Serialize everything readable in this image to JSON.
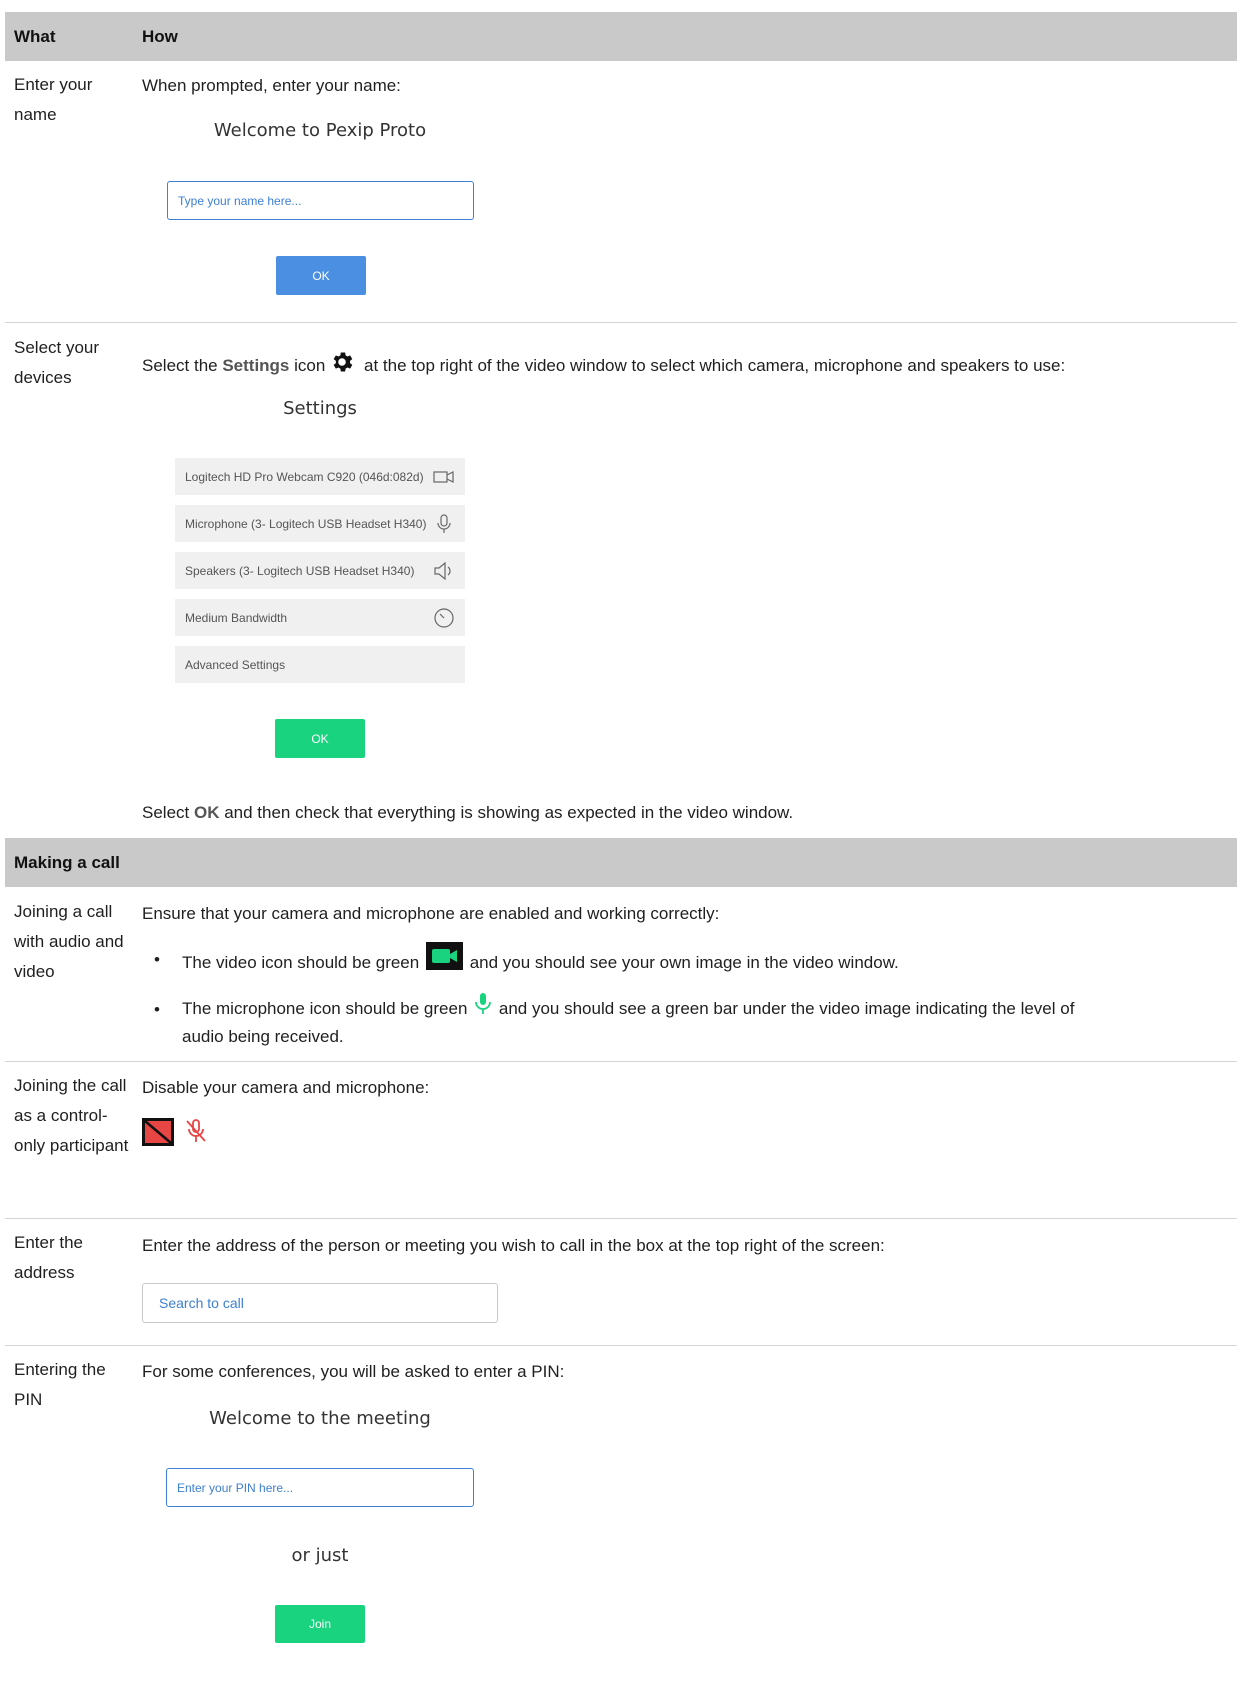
{
  "header": {
    "what": "What",
    "how": "How"
  },
  "rows": {
    "name": {
      "what": "Enter your name",
      "how": "When prompted, enter your name:",
      "ui_title": "Welcome to Pexip Proto",
      "ui_placeholder": "Type your name here...",
      "ui_button": "OK"
    },
    "devices": {
      "what": "Select your devices",
      "how_before": "Select the ",
      "how_bold": "Settings",
      "how_mid": " icon",
      "how_after": " at the top right of the video window to select which camera, microphone and speakers to use:",
      "ui_title": "Settings",
      "settings_items": [
        {
          "label": "Logitech HD Pro Webcam C920 (046d:082d)",
          "icon": "camera-icon"
        },
        {
          "label": "Microphone (3- Logitech USB Headset H340)",
          "icon": "microphone-icon"
        },
        {
          "label": "Speakers (3- Logitech USB Headset H340)",
          "icon": "speaker-icon"
        },
        {
          "label": "Medium Bandwidth",
          "icon": "speedometer-icon"
        },
        {
          "label": "Advanced Settings",
          "icon": ""
        }
      ],
      "ui_button": "OK",
      "footer_before": "Select ",
      "footer_bold": "OK",
      "footer_after": " and then check that everything is showing as expected in the video window."
    }
  },
  "section": {
    "title": "Making a call"
  },
  "call_rows": {
    "audio_video": {
      "what": "Joining a call with audio and video",
      "how": "Ensure that your camera and microphone are enabled and working correctly:",
      "bullet1_before": "The video icon should be green",
      "bullet1_after": "and you should see your own image in the video window.",
      "bullet2_before": "The microphone icon should be green",
      "bullet2_after": "and you should see a green bar under the video image indicating the level of",
      "bullet2_line2": "audio being received."
    },
    "control_only": {
      "what": "Joining the call as a control-only participant",
      "how": "Disable your camera and microphone:"
    },
    "address": {
      "what": "Enter the address",
      "how": "Enter the address of the person or meeting you wish to call in the box at the top right of the screen:",
      "search_placeholder": "Search to call"
    },
    "pin": {
      "what": "Entering the PIN",
      "how": "For some conferences, you will be asked to enter a PIN:",
      "ui_title": "Welcome to the meeting",
      "ui_placeholder": "Enter your PIN here...",
      "or_text": "or just",
      "ui_button": "Join"
    }
  },
  "colors": {
    "header_bg": "#c9c9c9",
    "blue": "#4a8fe2",
    "green": "#19d37f",
    "red": "#e84545"
  }
}
